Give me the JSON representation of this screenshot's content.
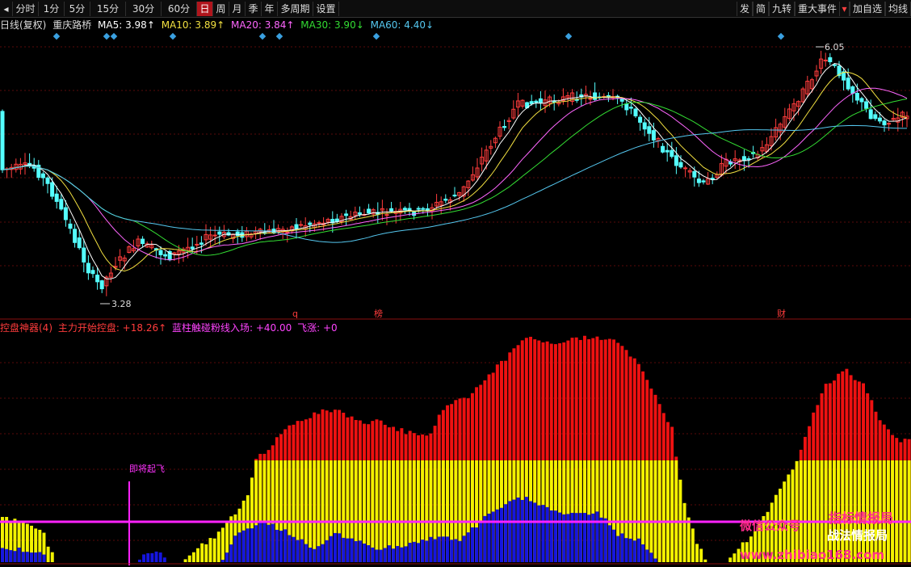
{
  "toolbar": {
    "left": [
      "分时",
      "1分",
      "5分",
      "15分",
      "30分",
      "60分",
      "日",
      "周",
      "月",
      "季",
      "年",
      "多周期",
      "设置"
    ],
    "active": "日",
    "right": [
      "发",
      "简",
      "九转",
      "重大事件",
      "加自选",
      "均线"
    ]
  },
  "ma_header": {
    "period": "日线(复权)",
    "name": "重庆路桥",
    "ma5": "MA5: 3.98↑",
    "ma10": "MA10: 3.89↑",
    "ma20": "MA20: 3.84↑",
    "ma30": "MA30: 3.90↓",
    "ma60": "MA60: 4.40↓"
  },
  "price_chart": {
    "high_label": "6.05",
    "low_label": "3.28",
    "markers": [
      "q",
      "榜",
      "财"
    ]
  },
  "indicator_header": {
    "name": "控盘神器(4)",
    "item1": "主力开始控盘: +18.26↑",
    "item2": "蓝柱触碰粉线入场: +40.00",
    "item3": "飞涨: +0"
  },
  "indicator_chart": {
    "annotation": "即将起飞"
  },
  "watermark": {
    "wechat": "微信公众号",
    "brand1": "指标情报局",
    "brand2": "战法情报局",
    "url": "www.zhibiao168.com"
  },
  "colors": {
    "up": "#ff3c3c",
    "down": "#54ffff",
    "bar_red": "#ee1111",
    "bar_yellow": "#f2f200",
    "bar_blue": "#1515e0",
    "pink": "#ff22ff",
    "ma5": "#ffffff",
    "ma10": "#f2e040",
    "ma20": "#ff66ff",
    "ma30": "#33dd33",
    "ma60": "#55c8f0"
  }
}
